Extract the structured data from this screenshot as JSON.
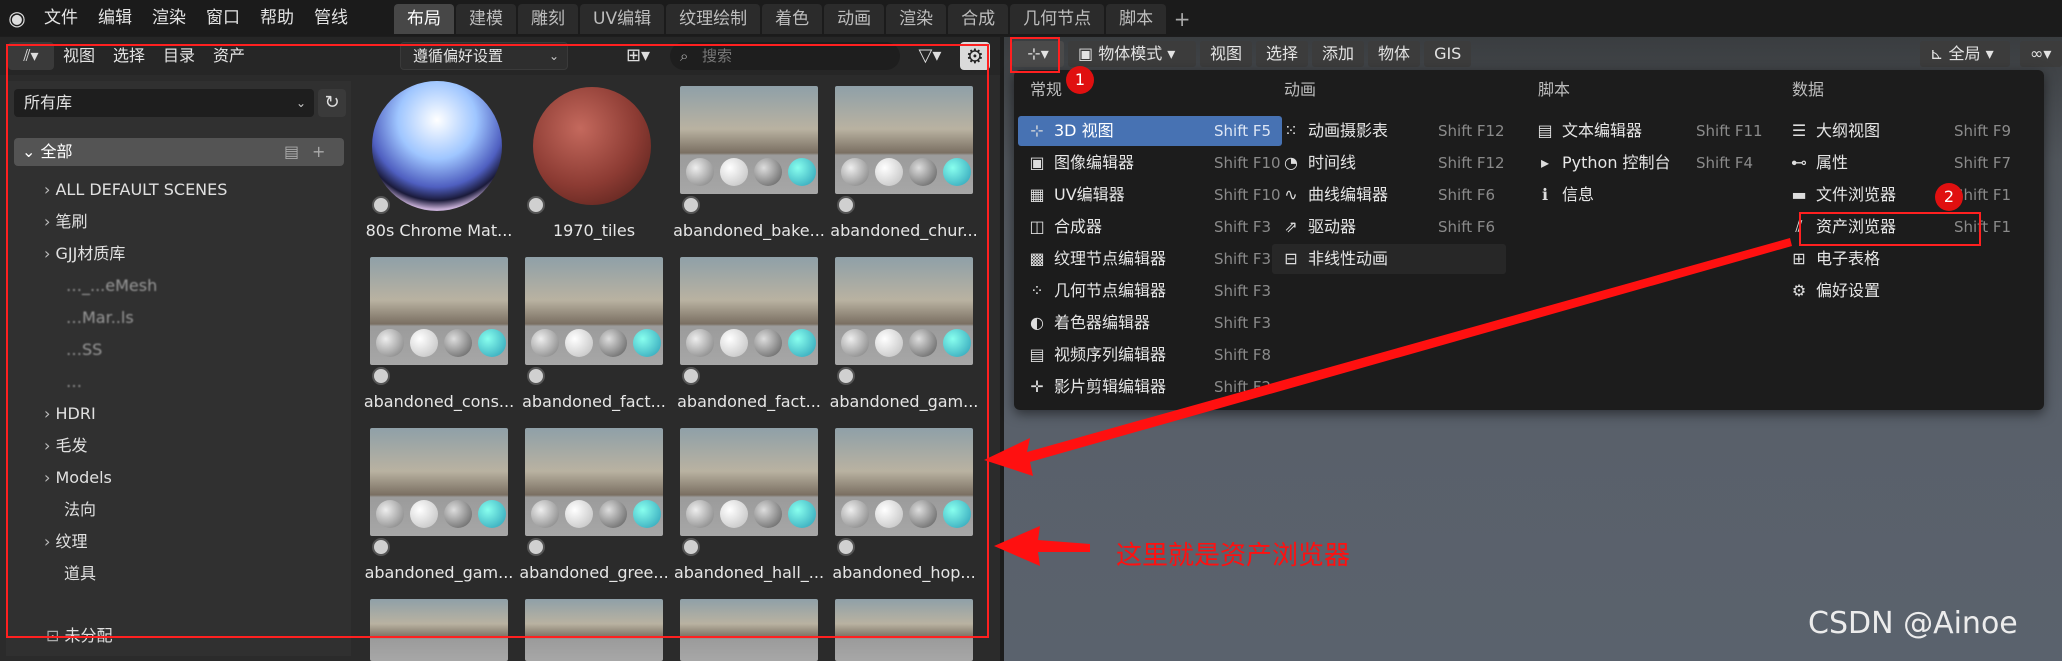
{
  "topbar": {
    "menu": [
      "文件",
      "编辑",
      "渲染",
      "窗口",
      "帮助",
      "管线"
    ],
    "workspaces": [
      "布局",
      "建模",
      "雕刻",
      "UV编辑",
      "纹理绘制",
      "着色",
      "动画",
      "渲染",
      "合成",
      "几何节点",
      "脚本"
    ],
    "active_workspace": "布局",
    "add_label": "+"
  },
  "asset_browser": {
    "header_menu": [
      "视图",
      "选择",
      "目录",
      "资产"
    ],
    "prefs_select": "遵循偏好设置",
    "search_placeholder": "搜索",
    "library": "所有库",
    "root_category": "全部",
    "categories": [
      {
        "label": "ALL DEFAULT SCENES",
        "expandable": true
      },
      {
        "label": "笔刷",
        "expandable": true
      },
      {
        "label": "GJJ材质库",
        "expandable": true
      },
      {
        "label": "…_...eMesh",
        "expandable": false,
        "blurred": true
      },
      {
        "label": "…Mar..ls",
        "expandable": false,
        "blurred": true
      },
      {
        "label": "…SS",
        "expandable": false,
        "blurred": true
      },
      {
        "label": "…",
        "expandable": false,
        "blurred": true
      },
      {
        "label": "HDRI",
        "expandable": true
      },
      {
        "label": "毛发",
        "expandable": true
      },
      {
        "label": "Models",
        "expandable": true
      },
      {
        "label": "法向",
        "expandable": false
      },
      {
        "label": "纹理",
        "expandable": true
      },
      {
        "label": "道具",
        "expandable": false
      }
    ],
    "unassigned": "未分配",
    "assets": [
      "80s Chrome Mat...",
      "1970_tiles",
      "abandoned_bake...",
      "abandoned_chur...",
      "abandoned_cons...",
      "abandoned_fact...",
      "abandoned_fact...",
      "abandoned_gam...",
      "abandoned_gam...",
      "abandoned_gree...",
      "abandoned_hall_...",
      "abandoned_hop..."
    ]
  },
  "viewport": {
    "mode": "物体模式",
    "menu": [
      "视图",
      "选择",
      "添加",
      "物体",
      "GIS"
    ],
    "transform_orient": "全局"
  },
  "editor_menu": {
    "columns": [
      {
        "head": "常规",
        "items": [
          {
            "icon": "3d-viewport-icon",
            "glyph": "⊹",
            "label": "3D 视图",
            "shortcut": "Shift F5",
            "active": true
          },
          {
            "icon": "image-editor-icon",
            "glyph": "▣",
            "label": "图像编辑器",
            "shortcut": "Shift F10"
          },
          {
            "icon": "uv-editor-icon",
            "glyph": "▦",
            "label": "UV编辑器",
            "shortcut": "Shift F10"
          },
          {
            "icon": "compositor-icon",
            "glyph": "◫",
            "label": "合成器",
            "shortcut": "Shift F3"
          },
          {
            "icon": "texture-node-icon",
            "glyph": "▩",
            "label": "纹理节点编辑器",
            "shortcut": "Shift F3"
          },
          {
            "icon": "geometry-node-icon",
            "glyph": "⁘",
            "label": "几何节点编辑器",
            "shortcut": "Shift F3"
          },
          {
            "icon": "shader-editor-icon",
            "glyph": "◐",
            "label": "着色器编辑器",
            "shortcut": "Shift F3"
          },
          {
            "icon": "sequencer-icon",
            "glyph": "▤",
            "label": "视频序列编辑器",
            "shortcut": "Shift F8"
          },
          {
            "icon": "clip-editor-icon",
            "glyph": "✛",
            "label": "影片剪辑编辑器",
            "shortcut": "Shift F2"
          }
        ]
      },
      {
        "head": "动画",
        "items": [
          {
            "icon": "dopesheet-icon",
            "glyph": "⁙",
            "label": "动画摄影表",
            "shortcut": "Shift F12"
          },
          {
            "icon": "timeline-icon",
            "glyph": "◔",
            "label": "时间线",
            "shortcut": "Shift F12"
          },
          {
            "icon": "graph-editor-icon",
            "glyph": "∿",
            "label": "曲线编辑器",
            "shortcut": "Shift F6"
          },
          {
            "icon": "drivers-icon",
            "glyph": "⇗",
            "label": "驱动器",
            "shortcut": "Shift F6"
          },
          {
            "icon": "nla-icon",
            "glyph": "⊟",
            "label": "非线性动画",
            "shortcut": "",
            "dim": true
          }
        ]
      },
      {
        "head": "脚本",
        "items": [
          {
            "icon": "text-editor-icon",
            "glyph": "▤",
            "label": "文本编辑器",
            "shortcut": "Shift F11"
          },
          {
            "icon": "python-console-icon",
            "glyph": "▸",
            "label": "Python 控制台",
            "shortcut": "Shift F4"
          },
          {
            "icon": "info-icon",
            "glyph": "ℹ",
            "label": "信息",
            "shortcut": ""
          }
        ]
      },
      {
        "head": "数据",
        "items": [
          {
            "icon": "outliner-icon",
            "glyph": "☰",
            "label": "大纲视图",
            "shortcut": "Shift F9"
          },
          {
            "icon": "properties-icon",
            "glyph": "⊷",
            "label": "属性",
            "shortcut": "Shift F7"
          },
          {
            "icon": "file-browser-icon",
            "glyph": "▬",
            "label": "文件浏览器",
            "shortcut": "Shift F1"
          },
          {
            "icon": "asset-browser-icon",
            "glyph": "⫽",
            "label": "资产浏览器",
            "shortcut": "Shift F1"
          },
          {
            "icon": "spreadsheet-icon",
            "glyph": "⊞",
            "label": "电子表格",
            "shortcut": ""
          },
          {
            "icon": "preferences-icon",
            "glyph": "⚙",
            "label": "偏好设置",
            "shortcut": ""
          }
        ]
      }
    ]
  },
  "annotations": {
    "marker1": "1",
    "marker2": "2",
    "text": "这里就是资产浏览器"
  },
  "watermark": "CSDN @Ainoe",
  "colors": {
    "accent": "#4772b3",
    "annotation": "#ff2020"
  }
}
